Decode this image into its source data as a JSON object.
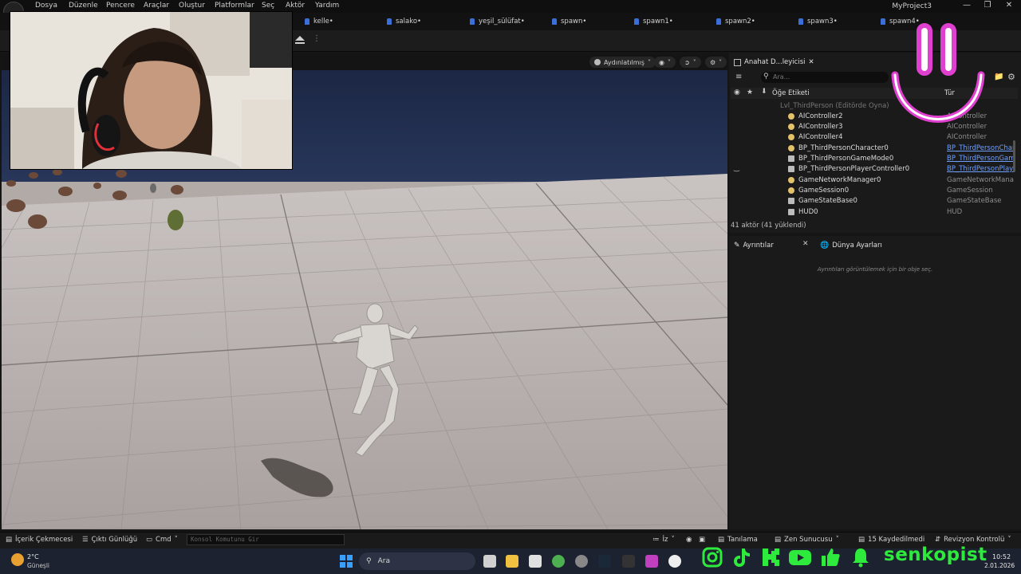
{
  "menubar": {
    "items": [
      "Dosya",
      "Düzenle",
      "Pencere",
      "Araçlar",
      "Oluştur",
      "Platformlar",
      "Seç",
      "Aktör",
      "Yardım"
    ],
    "project_title": "MyProject3"
  },
  "tabs": [
    "kelle•",
    "salako•",
    "yeşil_sülüfat•",
    "spawn•",
    "spawn1•",
    "spawn2•",
    "spawn3•",
    "spawn4•"
  ],
  "viewport": {
    "lighting_mode": "Aydınlatılmış"
  },
  "outliner": {
    "tab_label": "Anahat D...leyicisi",
    "search_placeholder": "Ara...",
    "col_label": "Öğe Etiketi",
    "col_type": "Tür",
    "level_row": "Lvl_ThirdPerson (Editörde Oyna)",
    "rows": [
      {
        "name": "AIController2",
        "type": "AIController"
      },
      {
        "name": "AIController3",
        "type": "AIController"
      },
      {
        "name": "AIController4",
        "type": "AIController"
      },
      {
        "name": "BP_ThirdPersonCharacter0",
        "type": "BP_ThirdPersonChar"
      },
      {
        "name": "BP_ThirdPersonGameMode0",
        "type": "BP_ThirdPersonGam"
      },
      {
        "name": "BP_ThirdPersonPlayerController0",
        "type": "BP_ThirdPersonPlaye"
      },
      {
        "name": "GameNetworkManager0",
        "type": "GameNetworkManag"
      },
      {
        "name": "GameSession0",
        "type": "GameSession"
      },
      {
        "name": "GameStateBase0",
        "type": "GameStateBase"
      },
      {
        "name": "HUD0",
        "type": "HUD"
      }
    ],
    "footer": "41 aktör (41 yüklendi)"
  },
  "details": {
    "tab_label": "Ayrıntılar",
    "world_tab_label": "Dünya Ayarları",
    "empty_message": "Ayrıntıları görüntülemek için bir obje seç."
  },
  "bottombar": {
    "content_drawer": "İçerik Çekmecesi",
    "output_log": "Çıktı Günlüğü",
    "cmd": "Cmd",
    "console_placeholder": "Konsol Komutunu Gir",
    "trace": "İz",
    "derive": "Tanılama",
    "zen": "Zen Sunucusu",
    "saved": "15 Kaydedilmedi",
    "revision": "Revizyon Kontrolü"
  },
  "taskbar": {
    "temperature": "2°C",
    "weather": "Güneşli",
    "search": "Ara",
    "time": "10:52",
    "date": "2.01.2026"
  },
  "overlay": {
    "brand": "senkopist",
    "accent_color": "#2eea3c",
    "smiley_color": "#e040d0"
  }
}
